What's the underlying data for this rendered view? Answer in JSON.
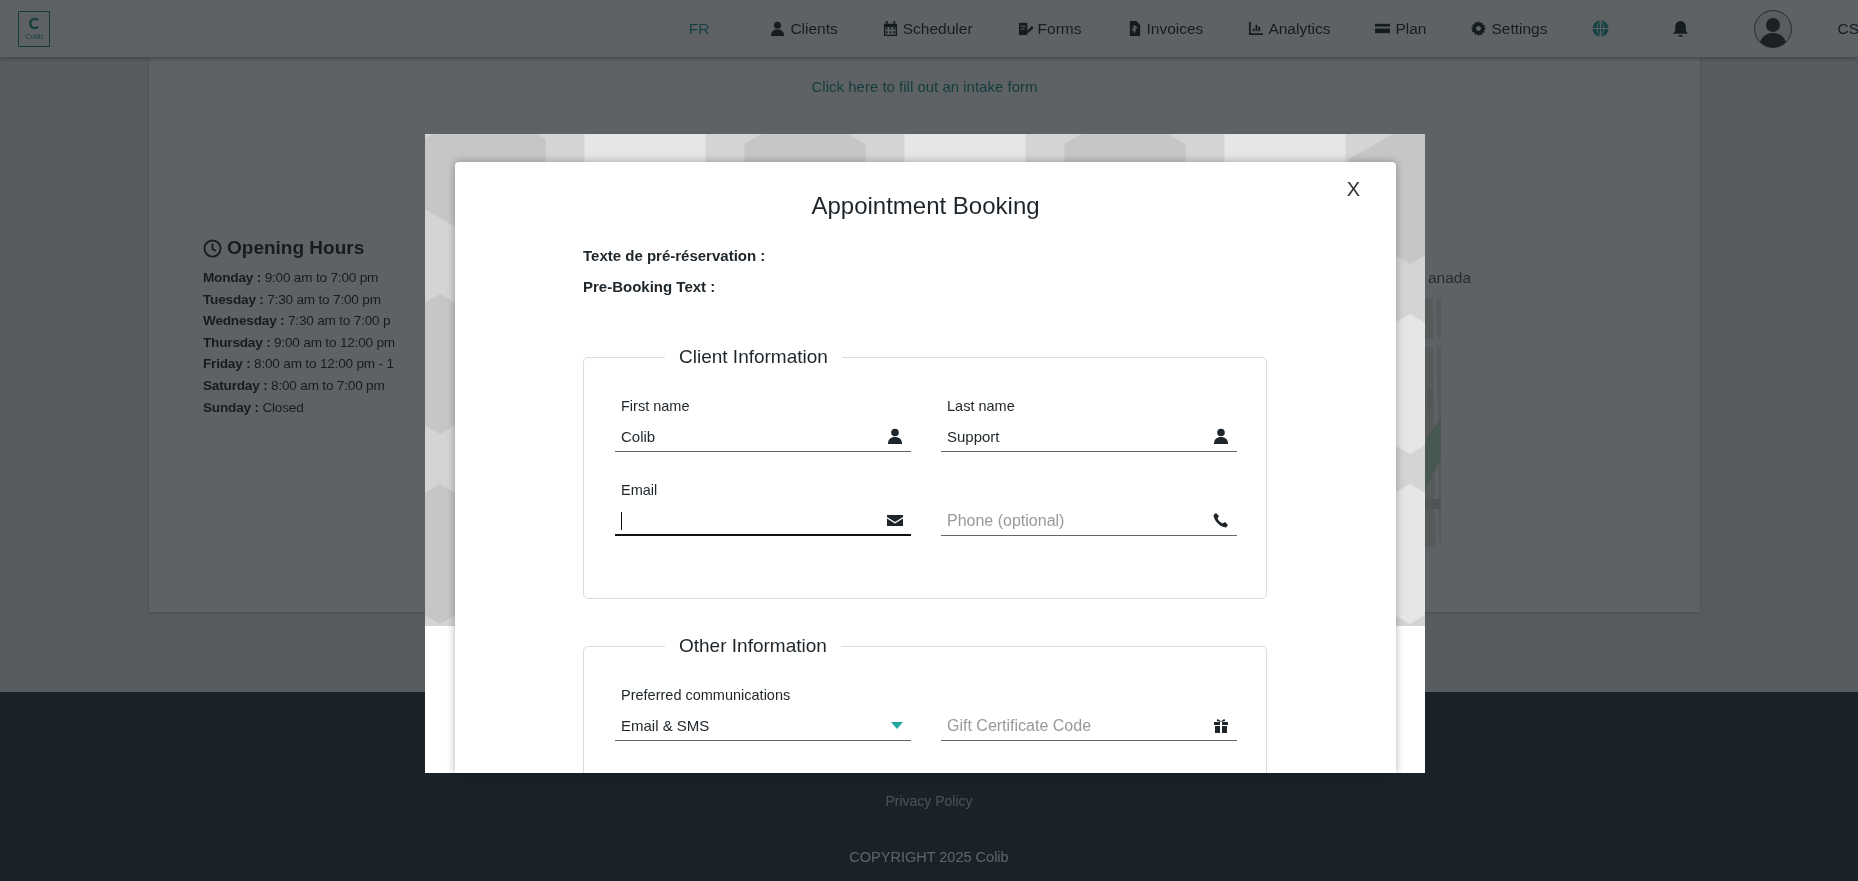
{
  "nav": {
    "logo_text": "Colib",
    "language": "FR",
    "items": [
      {
        "label": "Clients"
      },
      {
        "label": "Scheduler"
      },
      {
        "label": "Forms"
      },
      {
        "label": "Invoices"
      },
      {
        "label": "Analytics"
      },
      {
        "label": "Plan"
      },
      {
        "label": "Settings"
      }
    ],
    "user_initials": "CS"
  },
  "page": {
    "intake_link": "Click here to fill out an intake form",
    "opening_hours": {
      "title": "Opening Hours",
      "days": [
        {
          "day": "Monday :",
          "hours": "9:00 am to 7:00 pm"
        },
        {
          "day": "Tuesday :",
          "hours": "7:30 am to 7:00 pm"
        },
        {
          "day": "Wednesday :",
          "hours": "7:30 am to 7:00 p"
        },
        {
          "day": "Thursday :",
          "hours": "9:00 am to 12:00 pm"
        },
        {
          "day": "Friday :",
          "hours": "8:00 am to 12:00 pm - 1"
        },
        {
          "day": "Saturday :",
          "hours": "8:00 am to 7:00 pm"
        },
        {
          "day": "Sunday :",
          "hours": "Closed"
        }
      ]
    },
    "address_fragment": "anada"
  },
  "footer": {
    "privacy_link": "Privacy Policy",
    "copyright": "COPYRIGHT 2025 Colib"
  },
  "modal": {
    "title": "Appointment Booking",
    "close": "X",
    "pre_booking": [
      "Texte de pré-réservation :",
      "Pre-Booking Text :"
    ],
    "sections": [
      {
        "legend": "Client Information",
        "fields": [
          {
            "kind": "text",
            "label": "First name",
            "value": "Colib",
            "focused": false
          },
          {
            "kind": "text",
            "label": "Last name",
            "value": "Support",
            "focused": false
          },
          {
            "kind": "text",
            "label": "Email",
            "focused": true
          },
          {
            "kind": "text",
            "placeholder": "Phone (optional)",
            "focused": false
          }
        ]
      },
      {
        "legend": "Other Information",
        "fields": [
          {
            "kind": "select",
            "label": "Preferred communications",
            "value": "Email & SMS"
          },
          {
            "kind": "text",
            "placeholder": "Gift Certificate Code",
            "focused": false
          }
        ]
      }
    ]
  }
}
